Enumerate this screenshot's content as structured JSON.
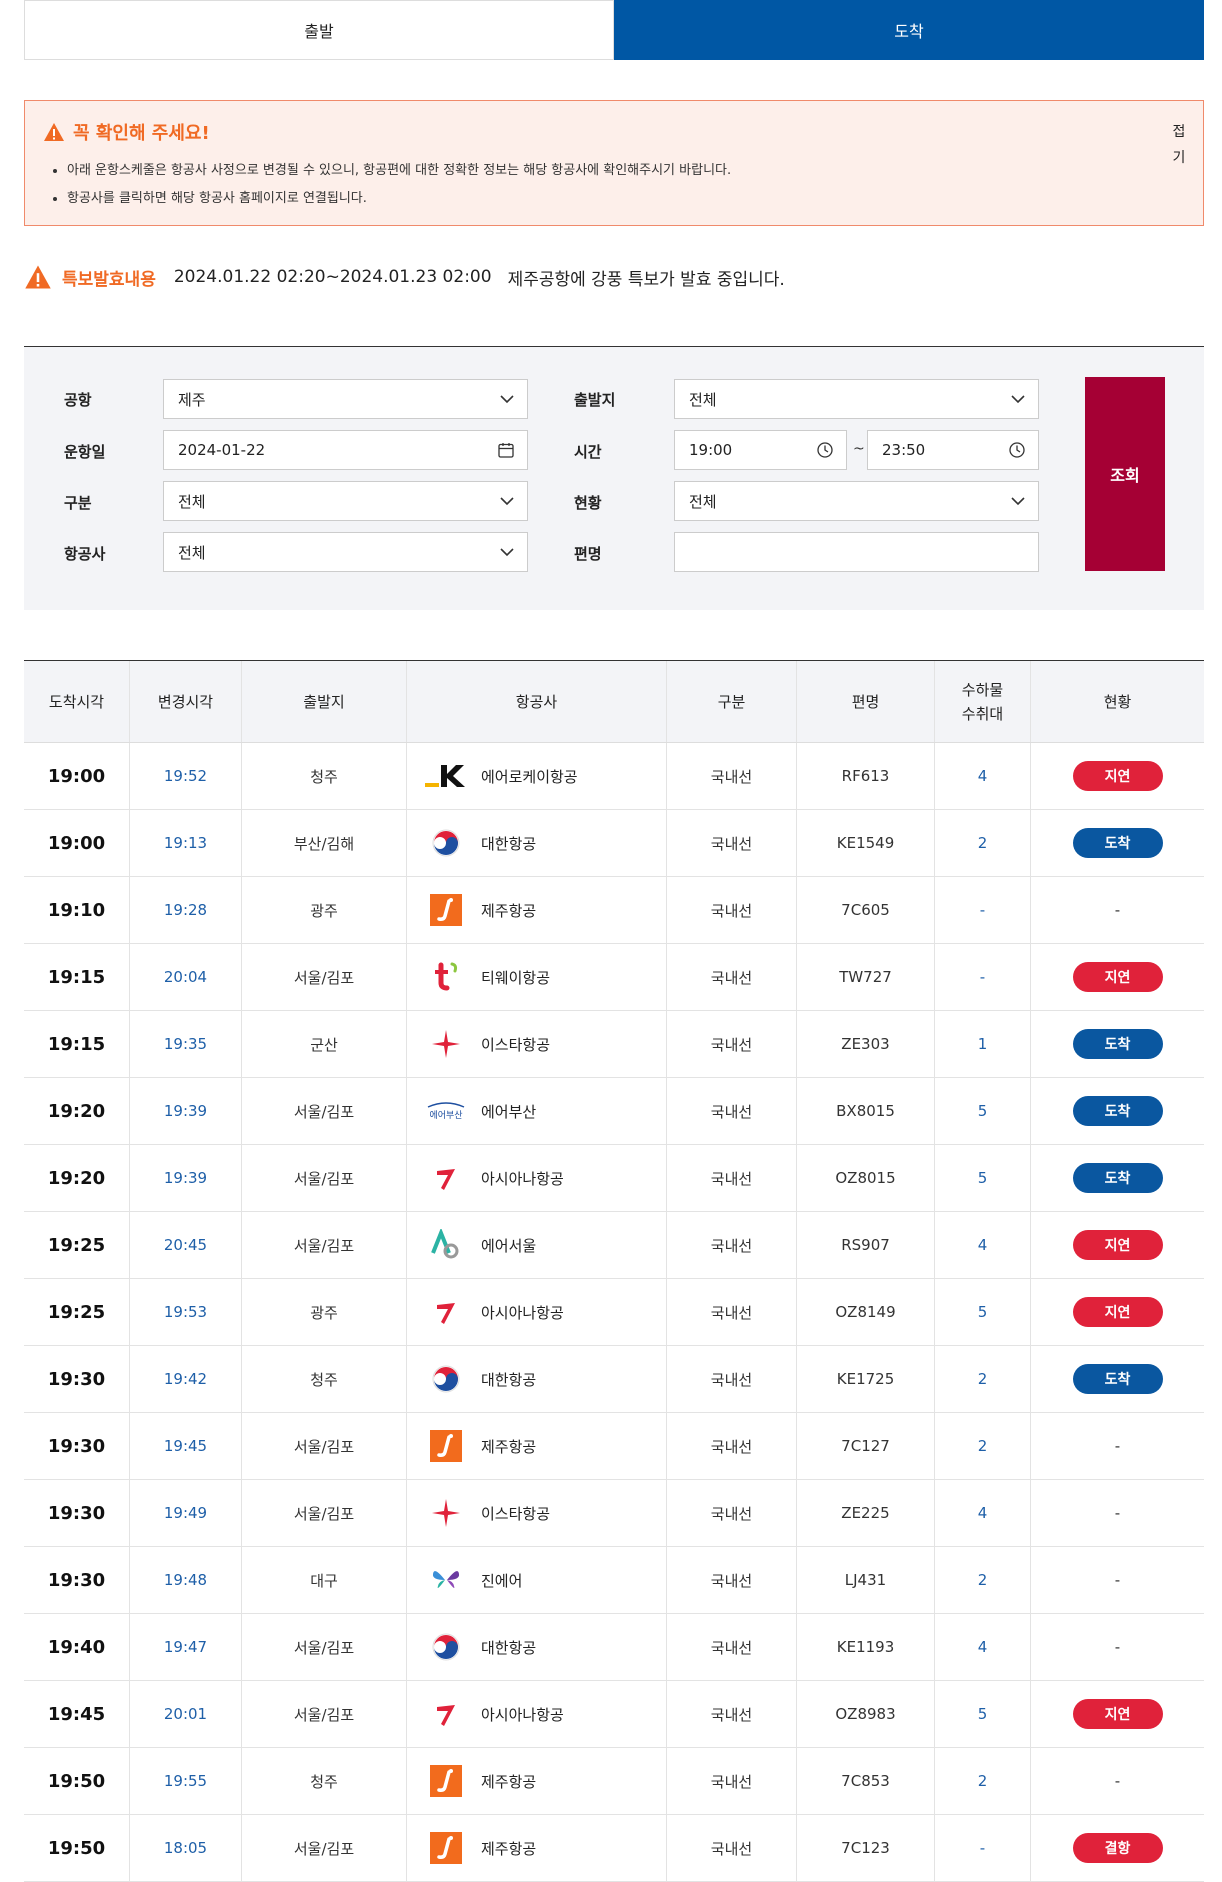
{
  "tabs": [
    {
      "label": "출발",
      "active": false
    },
    {
      "label": "도착",
      "active": true
    }
  ],
  "notice": {
    "title": "꼭 확인해 주세요!",
    "items": [
      "아래 운항스케줄은 항공사 사정으로 변경될 수 있으니, 항공편에 대한 정확한 정보는 해당 항공사에 확인해주시기 바랍니다.",
      "항공사를 클릭하면 해당 항공사 홈페이지로 연결됩니다."
    ],
    "more_label": "접기"
  },
  "alert": {
    "label": "특보발효내용",
    "period": "2024.01.22 02:20~2024.01.23 02:00",
    "text": "제주공항에 강풍 특보가 발효 중입니다."
  },
  "search": {
    "airport": {
      "label": "공항",
      "value": "제주"
    },
    "origin": {
      "label": "출발지",
      "value": "전체"
    },
    "date": {
      "label": "운항일",
      "value": "2024-01-22"
    },
    "time": {
      "label": "시간",
      "from": "19:00",
      "to": "23:50",
      "sep": "~"
    },
    "type": {
      "label": "구분",
      "value": "전체"
    },
    "status": {
      "label": "현황",
      "value": "전체"
    },
    "airline": {
      "label": "항공사",
      "value": "전체"
    },
    "flight": {
      "label": "편명",
      "value": ""
    },
    "submit_label": "조회"
  },
  "colors": {
    "accent_blue": "#0057a4",
    "search_button": "#a50034",
    "delay": "#e0223a",
    "arrive": "#0a57a0",
    "alert_orange": "#f06a24"
  },
  "table": {
    "headers": [
      "도착시각",
      "변경시각",
      "출발지",
      "항공사",
      "구분",
      "편명",
      "수하물\n수취대",
      "현황"
    ],
    "rows": [
      {
        "sched": "19:00",
        "changed": "19:52",
        "origin": "청주",
        "airline": "에어로케이항공",
        "logo": "aerok-logo",
        "type": "국내선",
        "flight": "RF613",
        "belt": "4",
        "status": "지연",
        "status_kind": "delay"
      },
      {
        "sched": "19:00",
        "changed": "19:13",
        "origin": "부산/김해",
        "airline": "대한항공",
        "logo": "koreanair-logo",
        "type": "국내선",
        "flight": "KE1549",
        "belt": "2",
        "status": "도착",
        "status_kind": "arrive"
      },
      {
        "sched": "19:10",
        "changed": "19:28",
        "origin": "광주",
        "airline": "제주항공",
        "logo": "jejuair-logo",
        "type": "국내선",
        "flight": "7C605",
        "belt": "-",
        "status": "-",
        "status_kind": "none"
      },
      {
        "sched": "19:15",
        "changed": "20:04",
        "origin": "서울/김포",
        "airline": "티웨이항공",
        "logo": "tway-logo",
        "type": "국내선",
        "flight": "TW727",
        "belt": "-",
        "status": "지연",
        "status_kind": "delay"
      },
      {
        "sched": "19:15",
        "changed": "19:35",
        "origin": "군산",
        "airline": "이스타항공",
        "logo": "eastar-logo",
        "type": "국내선",
        "flight": "ZE303",
        "belt": "1",
        "status": "도착",
        "status_kind": "arrive"
      },
      {
        "sched": "19:20",
        "changed": "19:39",
        "origin": "서울/김포",
        "airline": "에어부산",
        "logo": "airbusan-logo",
        "type": "국내선",
        "flight": "BX8015",
        "belt": "5",
        "status": "도착",
        "status_kind": "arrive"
      },
      {
        "sched": "19:20",
        "changed": "19:39",
        "origin": "서울/김포",
        "airline": "아시아나항공",
        "logo": "asiana-logo",
        "type": "국내선",
        "flight": "OZ8015",
        "belt": "5",
        "status": "도착",
        "status_kind": "arrive"
      },
      {
        "sched": "19:25",
        "changed": "20:45",
        "origin": "서울/김포",
        "airline": "에어서울",
        "logo": "airseoul-logo",
        "type": "국내선",
        "flight": "RS907",
        "belt": "4",
        "status": "지연",
        "status_kind": "delay"
      },
      {
        "sched": "19:25",
        "changed": "19:53",
        "origin": "광주",
        "airline": "아시아나항공",
        "logo": "asiana-logo",
        "type": "국내선",
        "flight": "OZ8149",
        "belt": "5",
        "status": "지연",
        "status_kind": "delay"
      },
      {
        "sched": "19:30",
        "changed": "19:42",
        "origin": "청주",
        "airline": "대한항공",
        "logo": "koreanair-logo",
        "type": "국내선",
        "flight": "KE1725",
        "belt": "2",
        "status": "도착",
        "status_kind": "arrive"
      },
      {
        "sched": "19:30",
        "changed": "19:45",
        "origin": "서울/김포",
        "airline": "제주항공",
        "logo": "jejuair-logo",
        "type": "국내선",
        "flight": "7C127",
        "belt": "2",
        "status": "-",
        "status_kind": "none"
      },
      {
        "sched": "19:30",
        "changed": "19:49",
        "origin": "서울/김포",
        "airline": "이스타항공",
        "logo": "eastar-logo",
        "type": "국내선",
        "flight": "ZE225",
        "belt": "4",
        "status": "-",
        "status_kind": "none"
      },
      {
        "sched": "19:30",
        "changed": "19:48",
        "origin": "대구",
        "airline": "진에어",
        "logo": "jinair-logo",
        "type": "국내선",
        "flight": "LJ431",
        "belt": "2",
        "status": "-",
        "status_kind": "none"
      },
      {
        "sched": "19:40",
        "changed": "19:47",
        "origin": "서울/김포",
        "airline": "대한항공",
        "logo": "koreanair-logo",
        "type": "국내선",
        "flight": "KE1193",
        "belt": "4",
        "status": "-",
        "status_kind": "none"
      },
      {
        "sched": "19:45",
        "changed": "20:01",
        "origin": "서울/김포",
        "airline": "아시아나항공",
        "logo": "asiana-logo",
        "type": "국내선",
        "flight": "OZ8983",
        "belt": "5",
        "status": "지연",
        "status_kind": "delay"
      },
      {
        "sched": "19:50",
        "changed": "19:55",
        "origin": "청주",
        "airline": "제주항공",
        "logo": "jejuair-logo",
        "type": "국내선",
        "flight": "7C853",
        "belt": "2",
        "status": "-",
        "status_kind": "none"
      },
      {
        "sched": "19:50",
        "changed": "18:05",
        "origin": "서울/김포",
        "airline": "제주항공",
        "logo": "jejuair-logo",
        "type": "국내선",
        "flight": "7C123",
        "belt": "-",
        "status": "결항",
        "status_kind": "cancel"
      }
    ]
  }
}
